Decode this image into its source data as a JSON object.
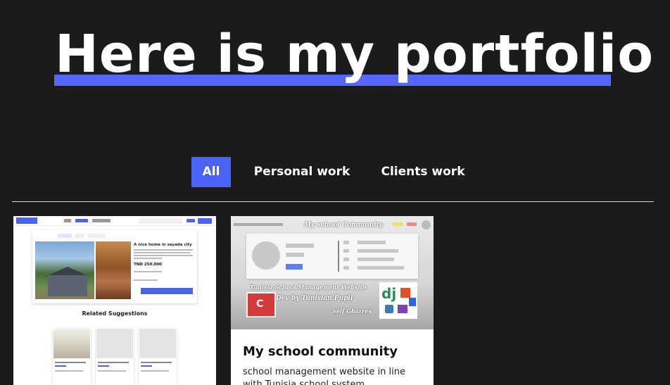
{
  "hero": {
    "title": "Here is my portfolio",
    "underline_color": "#5468ff"
  },
  "filters": {
    "items": [
      {
        "label": "All",
        "active": true
      },
      {
        "label": "Personal work",
        "active": false
      },
      {
        "label": "Clients work",
        "active": false
      }
    ],
    "active_color": "#4a63f7"
  },
  "projects": [
    {
      "preview": {
        "listing_title": "A nice home in sayada city",
        "listing_price": "TND 250.000",
        "related_heading": "Related Suggestions"
      }
    },
    {
      "preview": {
        "banner_title": "My school Community",
        "caption_main": "Tunisia School Management Website",
        "caption_dev": "Dev by Tunisian Pupil",
        "caption_author": "Seif Gharres",
        "logo_letter": "C",
        "tech_logo": "dj"
      },
      "title": "My school community",
      "description": "school management website in line with Tunisia school system"
    }
  ],
  "colors": {
    "background": "#1b1b1d",
    "accent": "#4a63f7"
  }
}
